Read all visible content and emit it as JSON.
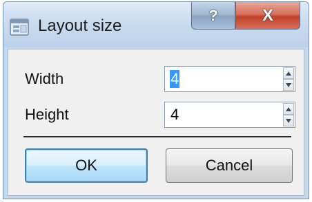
{
  "window": {
    "title": "Layout size",
    "help_label": "?",
    "close_label": "X"
  },
  "fields": [
    {
      "label": "Width",
      "value": "4",
      "selected": true
    },
    {
      "label": "Height",
      "value": "4",
      "selected": false
    }
  ],
  "buttons": {
    "ok_label": "OK",
    "cancel_label": "Cancel"
  },
  "icons": {
    "app": "dialog-app-icon",
    "spin_up": "spin-up-icon",
    "spin_down": "spin-down-icon"
  },
  "colors": {
    "title_bar": "#cadcf0",
    "close_button": "#c1412a",
    "selection": "#3399ff",
    "default_button_border": "#3c7fb1"
  }
}
